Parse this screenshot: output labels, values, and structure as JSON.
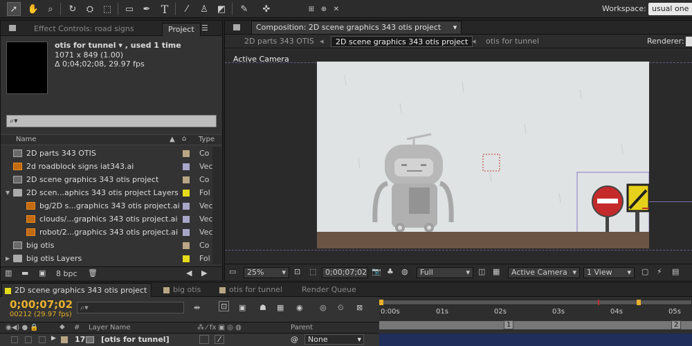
{
  "toolbar": {
    "workspace_label": "Workspace:",
    "workspace_value": "usual one",
    "tool_text_glyph": "T"
  },
  "project_panel": {
    "tab_effect_controls": "Effect Controls: road signs",
    "tab_project": "Project",
    "selected_item": {
      "name": "otis for tunnel ▾ , used 1 time",
      "dimensions": "1071 x 849 (1.00)",
      "duration": "Δ 0;04;02;08, 29.97 fps"
    },
    "search_placeholder": "⌕▾",
    "columns": {
      "name": "Name",
      "type": "Type"
    },
    "items": [
      {
        "name": "2D parts 343 OTIS",
        "type": "Co",
        "icon": "comp-icon",
        "label_color": "#b8a684",
        "indent": 0
      },
      {
        "name": "2d roadblock signs iat343.ai",
        "type": "Vec",
        "icon": "ai-file-icon",
        "label_color": "#a8a6c8",
        "indent": 0
      },
      {
        "name": "2D scene graphics 343 otis project",
        "type": "Co",
        "icon": "comp-icon",
        "label_color": "#b8a684",
        "indent": 0
      },
      {
        "name": "2D scen...aphics 343 otis project Layers",
        "type": "Fol",
        "icon": "folder-icon",
        "label_color": "#e6dc1a",
        "indent": 0,
        "expanded": true
      },
      {
        "name": "bg/2D s...graphics 343 otis project.ai",
        "type": "Vec",
        "icon": "ai-file-icon",
        "label_color": "#a8a6c8",
        "indent": 1
      },
      {
        "name": "clouds/...graphics 343 otis project.ai",
        "type": "Vec",
        "icon": "ai-file-icon",
        "label_color": "#a8a6c8",
        "indent": 1
      },
      {
        "name": "robot/2...graphics 343 otis project.ai",
        "type": "Vec",
        "icon": "ai-file-icon",
        "label_color": "#a8a6c8",
        "indent": 1
      },
      {
        "name": "big otis",
        "type": "Co",
        "icon": "comp-icon",
        "label_color": "#b8a684",
        "indent": 0
      },
      {
        "name": "big otis Layers",
        "type": "Fol",
        "icon": "folder-icon",
        "label_color": "#e6dc1a",
        "indent": 0,
        "expanded": false
      }
    ],
    "bit_depth": "8 bpc"
  },
  "composition_panel": {
    "tab_title": "Composition: 2D scene graphics 343 otis project",
    "breadcrumbs": [
      "2D parts 343 OTIS",
      "2D scene graphics 343 otis project",
      "otis for tunnel"
    ],
    "renderer_label": "Renderer:",
    "view_label": "Active Camera",
    "zoom": "25%",
    "timecode": "0;00;07;02",
    "resolution": "Full",
    "camera": "Active Camera",
    "views": "1 View"
  },
  "timeline": {
    "tabs": [
      {
        "label": "2D scene graphics 343 otis project",
        "color": "#e6dc1a",
        "active": true
      },
      {
        "label": "big otis",
        "color": "#b8a684",
        "active": false
      },
      {
        "label": "otis for tunnel",
        "color": "#b8a684",
        "active": false
      },
      {
        "label": "Render Queue",
        "color": "",
        "active": false
      }
    ],
    "current_time": "0;00;07;02",
    "frames": "00212 (29.97 fps)",
    "search_placeholder": "⌕▾",
    "columns": {
      "hash": "#",
      "layer_name": "Layer Name",
      "parent": "Parent"
    },
    "ruler_ticks": [
      "0:00s",
      "01s",
      "02s",
      "03s",
      "04s",
      "05s"
    ],
    "markers": [
      "1",
      "2"
    ],
    "layer": {
      "index": "17",
      "name": "[otis for tunnel]",
      "parent": "None"
    }
  }
}
